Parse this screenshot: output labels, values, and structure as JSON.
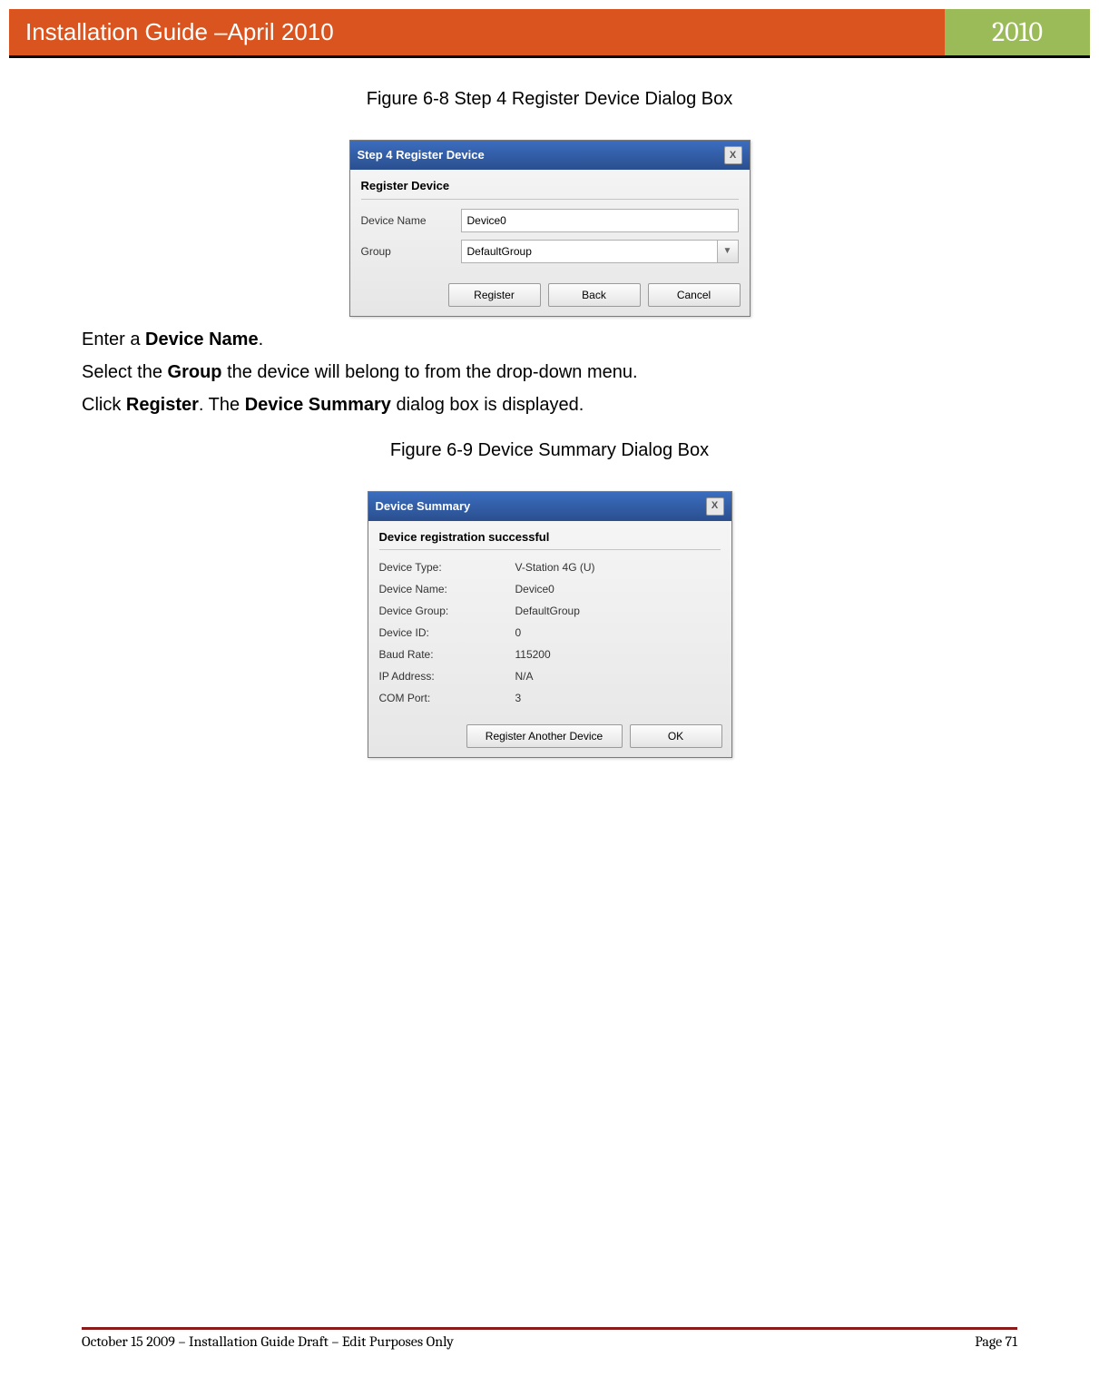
{
  "header": {
    "title": "Installation Guide –April 2010",
    "year": "2010"
  },
  "figure1": {
    "caption": "Figure 6-8 Step 4 Register Device Dialog Box"
  },
  "dialog1": {
    "title": "Step 4 Register Device",
    "section": "Register Device",
    "device_name_label": "Device Name",
    "device_name_value": "Device0",
    "group_label": "Group",
    "group_value": "DefaultGroup",
    "buttons": {
      "register": "Register",
      "back": "Back",
      "cancel": "Cancel"
    }
  },
  "instructions": {
    "line1": {
      "pre": "Enter a ",
      "bold": "Device Name",
      "post": "."
    },
    "line2": {
      "pre": "Select the ",
      "bold": "Group",
      "post": " the device will belong to from the drop-down menu."
    },
    "line3": {
      "pre": "Click ",
      "bold1": "Register",
      "mid": ". The ",
      "bold2": "Device Summary",
      "post": " dialog box is displayed."
    }
  },
  "figure2": {
    "caption": "Figure 6-9 Device Summary Dialog Box"
  },
  "dialog2": {
    "title": "Device Summary",
    "section": "Device registration successful",
    "rows": [
      {
        "label": "Device Type:",
        "value": "V-Station 4G (U)"
      },
      {
        "label": "Device Name:",
        "value": "Device0"
      },
      {
        "label": "Device Group:",
        "value": "DefaultGroup"
      },
      {
        "label": "Device ID:",
        "value": "0"
      },
      {
        "label": "Baud Rate:",
        "value": "115200"
      },
      {
        "label": "IP Address:",
        "value": "N/A"
      },
      {
        "label": "COM Port:",
        "value": "3"
      }
    ],
    "buttons": {
      "another": "Register Another Device",
      "ok": "OK"
    }
  },
  "footer": {
    "left": "October 15 2009 – Installation Guide Draft – Edit Purposes Only",
    "right": "Page 71"
  }
}
